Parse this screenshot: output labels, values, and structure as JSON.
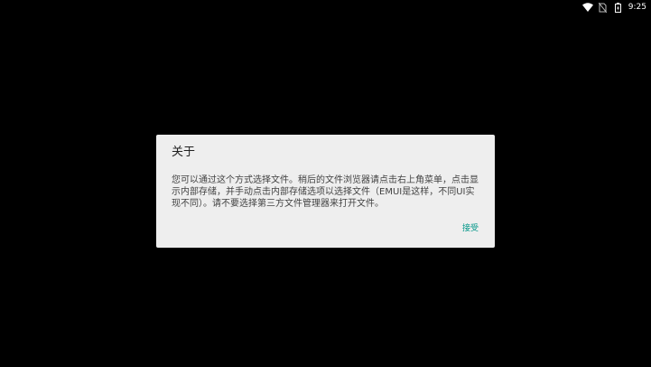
{
  "status_bar": {
    "time": "9:25",
    "icons": [
      "wifi-icon",
      "no-sim-icon",
      "battery-icon"
    ]
  },
  "dialog": {
    "title": "关于",
    "message": "您可以通过这个方式选择文件。稍后的文件浏览器请点击右上角菜单，点击显示内部存储，并手动点击内部存储选项以选择文件（EMUI是这样，不同UI实现不同）。请不要选择第三方文件管理器来打开文件。",
    "accept_label": "接受",
    "accent_color": "#009688"
  }
}
